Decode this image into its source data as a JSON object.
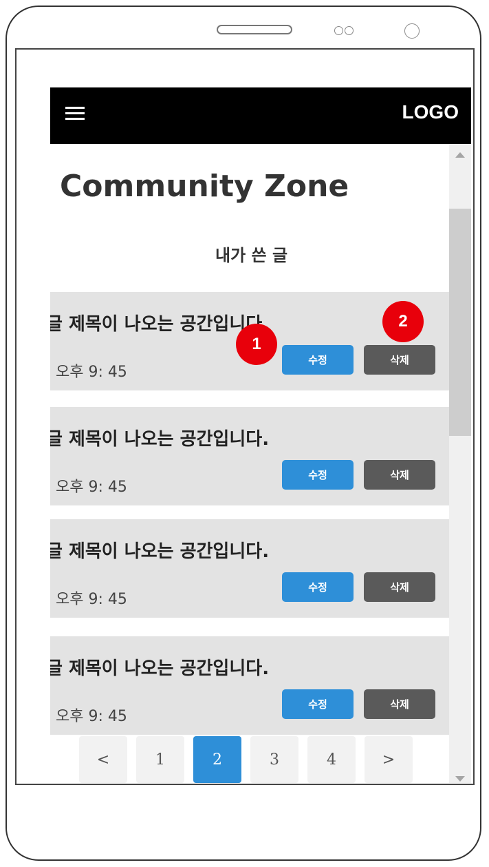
{
  "appbar": {
    "menu_icon": "hamburger-menu-icon",
    "logo": "LOGO"
  },
  "page": {
    "title": "Community Zone",
    "section": "내가 쓴 글"
  },
  "posts": [
    {
      "title": "글 제목이 나오는 공간입니다.",
      "time": "오후 9: 45",
      "edit_label": "수정",
      "delete_label": "삭제"
    },
    {
      "title": "글 제목이 나오는 공간입니다.",
      "time": "오후 9: 45",
      "edit_label": "수정",
      "delete_label": "삭제"
    },
    {
      "title": "글 제목이 나오는 공간입니다.",
      "time": "오후 9: 45",
      "edit_label": "수정",
      "delete_label": "삭제"
    },
    {
      "title": "글 제목이 나오는 공간입니다.",
      "time": "오후 9: 45",
      "edit_label": "수정",
      "delete_label": "삭제"
    }
  ],
  "pagination": {
    "prev": "<",
    "pages": [
      "1",
      "2",
      "3",
      "4"
    ],
    "current": "2",
    "next": ">"
  },
  "annotations": {
    "marker_1": "1",
    "marker_2": "2"
  },
  "colors": {
    "accent": "#2e8fd8",
    "delete": "#5a5a5a",
    "marker": "#e8000b",
    "card": "#e3e3e3",
    "appbar": "#000000"
  }
}
